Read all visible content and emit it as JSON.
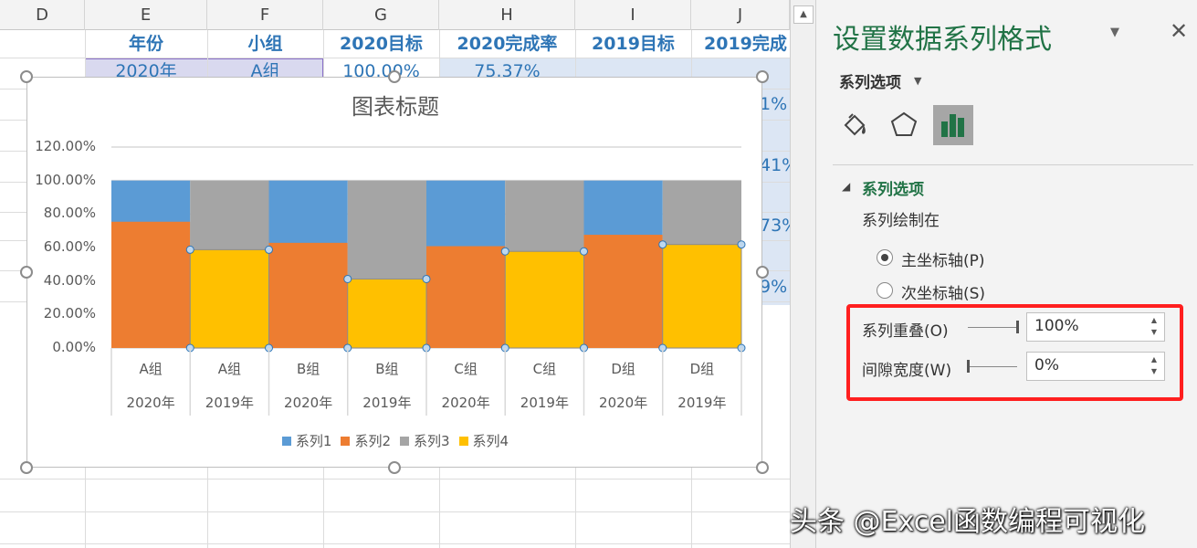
{
  "spreadsheet": {
    "columns": [
      "D",
      "E",
      "F",
      "G",
      "H",
      "I",
      "J"
    ],
    "headers": [
      "年份",
      "小组",
      "2020目标",
      "2020完成率",
      "2019目标",
      "2019完成"
    ],
    "first_row": [
      "2020年",
      "A组",
      "100.00%",
      "75.37%"
    ],
    "peek_values": [
      "1%",
      "41%",
      "73%",
      "9%"
    ]
  },
  "chart": {
    "title": "图表标题",
    "legend": [
      {
        "name": "系列1",
        "color": "#5b9bd5"
      },
      {
        "name": "系列2",
        "color": "#ed7d31"
      },
      {
        "name": "系列3",
        "color": "#a5a5a5"
      },
      {
        "name": "系列4",
        "color": "#ffc000"
      }
    ],
    "y_ticks": [
      "120.00%",
      "100.00%",
      "80.00%",
      "60.00%",
      "40.00%",
      "20.00%",
      "0.00%"
    ]
  },
  "chart_data": {
    "type": "bar",
    "stacked": "overlap",
    "categories": [
      [
        "A组",
        "2020年"
      ],
      [
        "A组",
        "2019年"
      ],
      [
        "B组",
        "2020年"
      ],
      [
        "B组",
        "2019年"
      ],
      [
        "C组",
        "2020年"
      ],
      [
        "C组",
        "2019年"
      ],
      [
        "D组",
        "2020年"
      ],
      [
        "D组",
        "2019年"
      ]
    ],
    "series": [
      {
        "name": "系列1",
        "color": "#5b9bd5",
        "values": [
          100,
          null,
          100,
          null,
          100,
          null,
          100,
          null
        ]
      },
      {
        "name": "系列2",
        "color": "#ed7d31",
        "values": [
          75.4,
          null,
          62.8,
          null,
          60.8,
          null,
          67.6,
          null
        ]
      },
      {
        "name": "系列3",
        "color": "#a5a5a5",
        "values": [
          null,
          100,
          null,
          100,
          null,
          100,
          null,
          100
        ]
      },
      {
        "name": "系列4",
        "color": "#ffc000",
        "values": [
          null,
          58.7,
          null,
          41.2,
          null,
          57.7,
          null,
          61.8
        ]
      }
    ],
    "ylim": [
      0,
      120
    ],
    "grid": true,
    "legend_position": "bottom",
    "title": "图表标题",
    "selected_series": "系列4"
  },
  "pane": {
    "title": "设置数据系列格式",
    "options_menu": "系列选项",
    "section_title": "系列选项",
    "plot_on": "系列绘制在",
    "primary_axis": "主坐标轴(P)",
    "secondary_axis": "次坐标轴(S)",
    "overlap_label": "系列重叠(O)",
    "overlap_value": "100%",
    "overlap_fraction": 1.0,
    "gap_label": "间隙宽度(W)",
    "gap_value": "0%",
    "gap_fraction": 0.0,
    "close": "✕",
    "dropdown": "▼",
    "highlight_color": "#ff1f1f"
  },
  "watermark": "头条 @Excel函数编程可视化"
}
